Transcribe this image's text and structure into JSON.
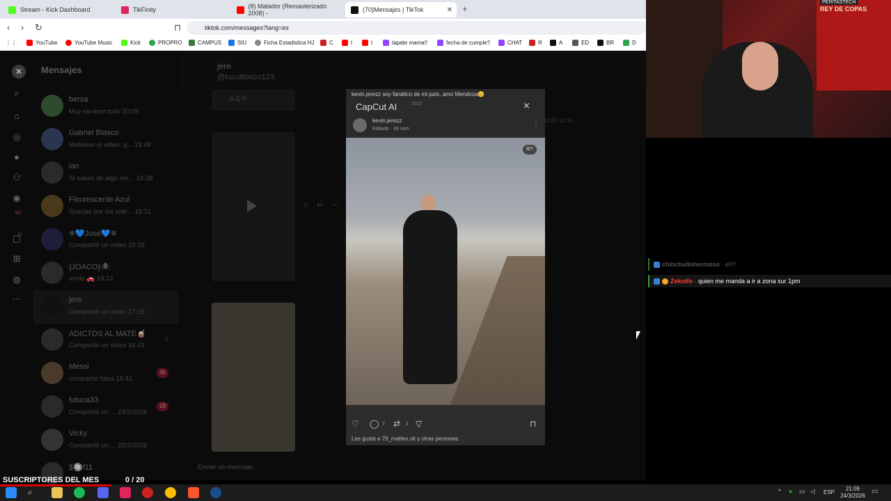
{
  "browser": {
    "tabs": [
      {
        "label": "Stream - Kick Dashboard",
        "color": "#53fc18"
      },
      {
        "label": "TikFinity",
        "color": "#e0245e"
      },
      {
        "label": "(8) Matador (Remasterizado 2008) - ",
        "color": "#ff0000"
      },
      {
        "label": "(70)Mensajes | TikTok",
        "color": "#111111"
      }
    ],
    "url": "tiktok.com/messages?lang=es",
    "bookmarks": [
      {
        "label": "YouTube",
        "color": "#ff0000"
      },
      {
        "label": "YouTube Music",
        "color": "#ff0000"
      },
      {
        "label": "Kick",
        "color": "#53fc18"
      },
      {
        "label": "PROPRO",
        "color": "#2ea44f"
      },
      {
        "label": "CAMPUS",
        "color": "#3a7a3a"
      },
      {
        "label": "SIU",
        "color": "#1a73e8"
      },
      {
        "label": "Ficha Estadistica HJ",
        "color": "#888888"
      },
      {
        "label": "C",
        "color": "#cc2222"
      },
      {
        "label": "t",
        "color": "#ff0000"
      },
      {
        "label": "t",
        "color": "#ff0000"
      },
      {
        "label": "tapate mama!!",
        "color": "#9146ff"
      },
      {
        "label": "fecha de cumple?",
        "color": "#9146ff"
      },
      {
        "label": "CHAT",
        "color": "#9146ff"
      },
      {
        "label": "R",
        "color": "#cc2222"
      },
      {
        "label": "A",
        "color": "#111111"
      },
      {
        "label": "ED",
        "color": "#555555"
      },
      {
        "label": "BR",
        "color": "#111111"
      },
      {
        "label": "D",
        "color": "#2ea44f"
      }
    ]
  },
  "tiktok": {
    "title": "Mensajes",
    "conversations": [
      {
        "name": "bersa",
        "preview": "Muy random todo 20:08",
        "badge": ""
      },
      {
        "name": "Gabriel Blasco",
        "preview": "Malisimo el video, g... 19:48",
        "badge": ""
      },
      {
        "name": "ian",
        "preview": "Si sabes de algo me... 19:38",
        "badge": ""
      },
      {
        "name": "Flourescente Azul",
        "preview": "Gracias por los vide... 19:31",
        "badge": ""
      },
      {
        "name": "❄💙José💙❄",
        "preview": "Compartió un video 19:16",
        "badge": ""
      },
      {
        "name": "{JOACO}🕷",
        "preview": "envió 🚗 19:12",
        "badge": ""
      },
      {
        "name": "jere",
        "preview": "Compartió un video 17:15",
        "badge": ""
      },
      {
        "name": "ADICTOS AL MATE🧉",
        "preview": "Compartió un video 16:41",
        "badge": ""
      },
      {
        "name": "Messi",
        "preview": "compartió fotos 15:41",
        "badge": "35"
      },
      {
        "name": "tutuca33",
        "preview": "Compartió un ... 23/3/2026",
        "badge": "19"
      },
      {
        "name": "Vicky",
        "preview": "Compartió un ... 22/3/2026",
        "badge": ""
      },
      {
        "name": "$🔘f11",
        "preview": "",
        "badge": ""
      }
    ],
    "rail_badges": [
      "60",
      "11"
    ],
    "chat_name": "jere",
    "chat_handle": "@tucuiltorico123",
    "thumb_label": "A G P",
    "composer_placeholder": "Enviar un mensaje...",
    "timestamp": "2026 14:39"
  },
  "video": {
    "caption": "kevin.jerezz soy fanático de mi país, amo Mendoza😊",
    "watermark": "CapCut AI",
    "date_hint": "2022",
    "post_user": "kevin.jerezz",
    "post_sub": "Editado · 39 sem",
    "page_count": "8/7",
    "comments": "7",
    "shares": "1",
    "likes_text": "Les gusta a 79_matteo.ok y otras personas"
  },
  "webcam": {
    "flag_text": "REY DE COPAS",
    "sign_text": "PERITASTECH"
  },
  "stream_chat": [
    {
      "user": "chinchullohermoso",
      "message": "eh?",
      "user_color": "#555555"
    },
    {
      "user": "Zeknifo",
      "message": "quien me manda a ir a zona sur 1pm",
      "user_color": "#ff3b3b"
    }
  ],
  "overlay": {
    "subs_label": "SUSCRIPTORES DEL MES",
    "subs_count": "0 / 20"
  },
  "taskbar": {
    "lang": "ESP",
    "time": "21:09",
    "date": "24/3/2026"
  }
}
